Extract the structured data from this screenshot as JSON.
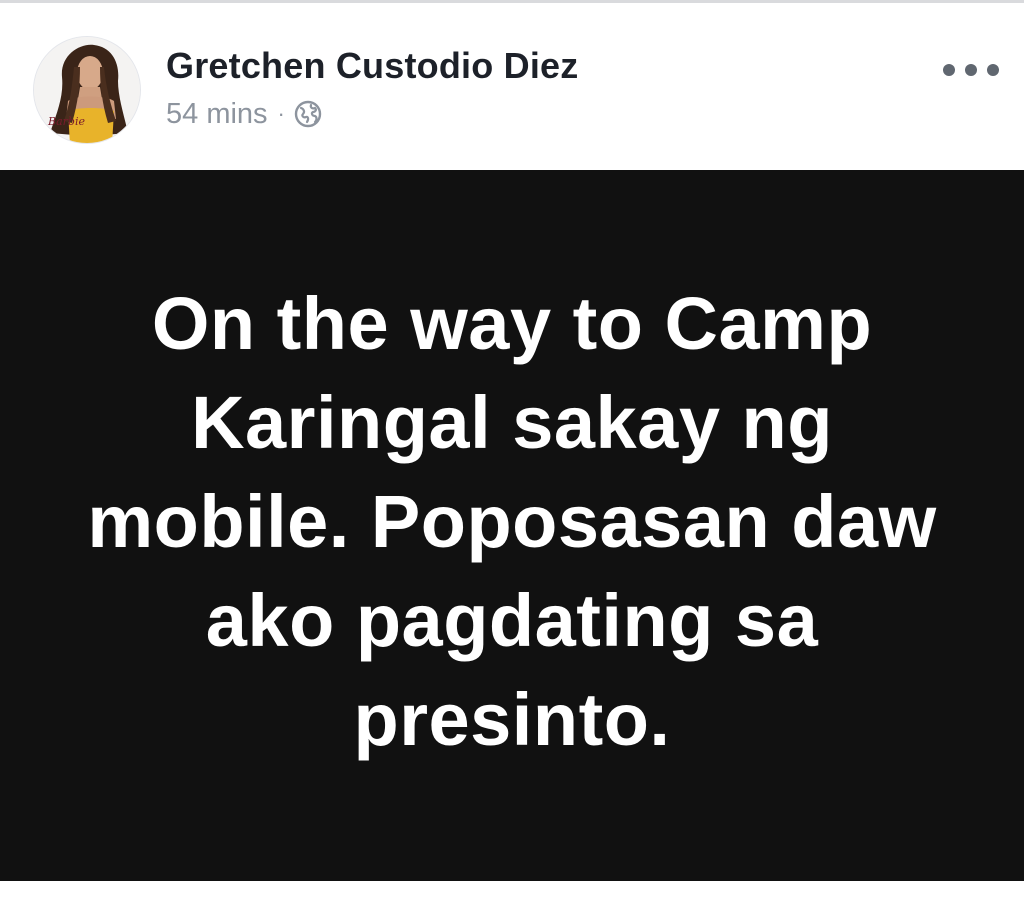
{
  "post": {
    "author": "Gretchen Custodio Diez",
    "timestamp": "54 mins",
    "separator": "·",
    "privacy_icon": "globe-icon",
    "more_icon": "more-options-icon",
    "status_text": "On the way to Camp Karingal sakay ng mobile. Poposasan daw ako pagdating sa presinto.",
    "avatar_caption": "Barbie"
  },
  "colors": {
    "card_background": "#111111",
    "text_on_card": "#ffffff",
    "author_text": "#1d2129",
    "meta_text": "#8d949e"
  }
}
